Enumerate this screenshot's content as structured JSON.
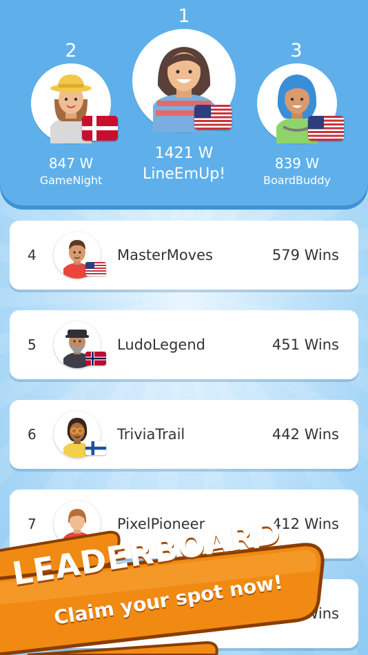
{
  "podium": [
    {
      "rank": "2",
      "score": "847 W",
      "name": "GameNight",
      "flag": "denmark"
    },
    {
      "rank": "1",
      "score": "1421 W",
      "name": "LineEmUp!",
      "flag": "usa"
    },
    {
      "rank": "3",
      "score": "839 W",
      "name": "BoardBuddy",
      "flag": "usa"
    }
  ],
  "rows": [
    {
      "rank": "4",
      "name": "MasterMoves",
      "wins": "579 Wins",
      "flag": "usa"
    },
    {
      "rank": "5",
      "name": "LudoLegend",
      "wins": "451 Wins",
      "flag": "norway"
    },
    {
      "rank": "6",
      "name": "TriviaTrail",
      "wins": "442 Wins",
      "flag": "finland"
    },
    {
      "rank": "7",
      "name": "PixelPioneer",
      "wins": "412 Wins",
      "flag": "none"
    },
    {
      "rank": "",
      "name": "",
      "wins": "Wins",
      "flag": "none"
    }
  ],
  "banner": {
    "title": "LEADERBOARD",
    "subtitle": "Claim your spot now!"
  },
  "colors": {
    "header_blue": "#5fb0ea",
    "banner_orange": "#f08a12",
    "banner_outline": "#8a3d00"
  }
}
